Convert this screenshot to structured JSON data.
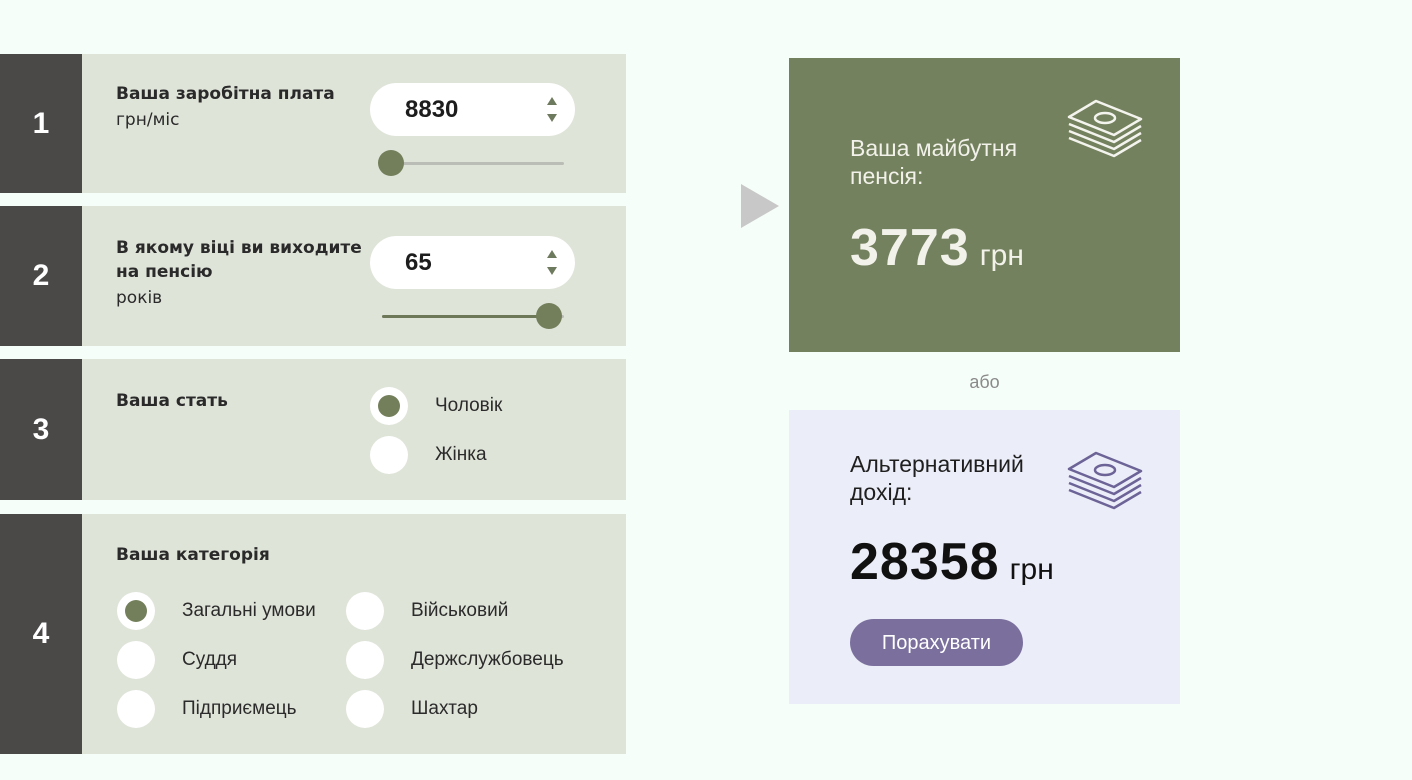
{
  "steps": {
    "s1": {
      "number": "1",
      "title": "Ваша заробітна плата",
      "unit": "грн/міс",
      "value": "8830",
      "slider_fraction": 0.05
    },
    "s2": {
      "number": "2",
      "title_line1": "В якому віці ви виходите",
      "title_line2": "на пенсію",
      "unit": "років",
      "value": "65",
      "slider_fraction": 0.92
    },
    "s3": {
      "number": "3",
      "title": "Ваша стать",
      "options": [
        {
          "label": "Чоловік",
          "selected": true
        },
        {
          "label": "Жінка",
          "selected": false
        }
      ]
    },
    "s4": {
      "number": "4",
      "title": "Ваша категорія",
      "options": [
        {
          "label": "Загальні умови",
          "selected": true
        },
        {
          "label": "Військовий",
          "selected": false
        },
        {
          "label": "Суддя",
          "selected": false
        },
        {
          "label": "Держслужбовець",
          "selected": false
        },
        {
          "label": "Підприємець",
          "selected": false
        },
        {
          "label": "Шахтар",
          "selected": false
        }
      ]
    }
  },
  "pension": {
    "title": "Ваша майбутня пенсія:",
    "amount": "3773",
    "currency": "грн",
    "icon": "money-stack-icon"
  },
  "or_label": "або",
  "alternative": {
    "title": "Альтернативний дохід:",
    "amount": "28358",
    "currency": "грн",
    "icon": "money-stack-icon",
    "button_label": "Порахувати"
  },
  "colors": {
    "step_number_bg": "#4b4848",
    "step_body_bg": "#dfe4d9",
    "accent_green": "#737f5b",
    "pension_bg": "#74815e",
    "alt_bg": "#ebedf8",
    "button_purple": "#7a6f9d"
  }
}
